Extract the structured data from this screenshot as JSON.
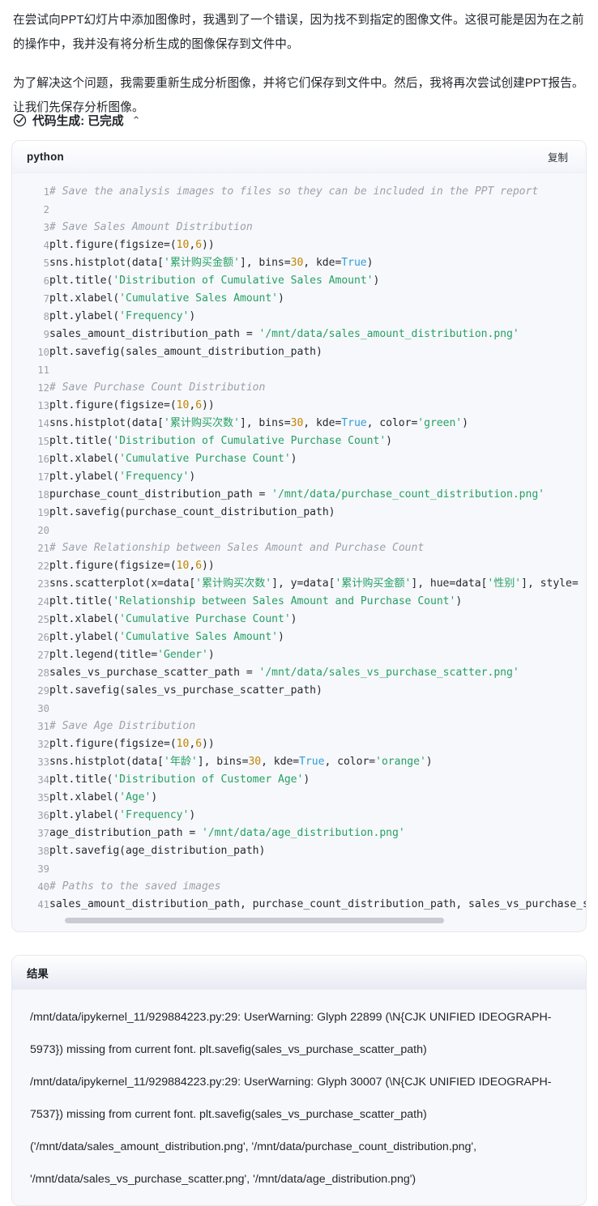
{
  "prose": {
    "paragraphs": [
      "在尝试向PPT幻灯片中添加图像时，我遇到了一个错误，因为找不到指定的图像文件。这很可能是因为在之前的操作中，我并没有将分析生成的图像保存到文件中。",
      "为了解决这个问题，我需要重新生成分析图像，并将它们保存到文件中。然后，我将再次尝试创建PPT报告。让我们先保存分析图像。"
    ]
  },
  "status": {
    "icon": "check-circle-icon",
    "label": "代码生成: 已完成",
    "caret": "⌃"
  },
  "code_block": {
    "language": "python",
    "copy_label": "复制",
    "line_numbers": [
      "1",
      "2",
      "3",
      "4",
      "5",
      "6",
      "7",
      "8",
      "9",
      "10",
      "11",
      "12",
      "13",
      "14",
      "15",
      "16",
      "17",
      "18",
      "19",
      "20",
      "21",
      "22",
      "23",
      "24",
      "25",
      "26",
      "27",
      "28",
      "29",
      "30",
      "31",
      "32",
      "33",
      "34",
      "35",
      "36",
      "37",
      "38",
      "39",
      "40",
      "41"
    ],
    "lines": [
      "# Save the analysis images to files so they can be included in the PPT report",
      "",
      "# Save Sales Amount Distribution",
      "plt.figure(figsize=(10,6))",
      "sns.histplot(data['累计购买金额'], bins=30, kde=True)",
      "plt.title('Distribution of Cumulative Sales Amount')",
      "plt.xlabel('Cumulative Sales Amount')",
      "plt.ylabel('Frequency')",
      "sales_amount_distribution_path = '/mnt/data/sales_amount_distribution.png'",
      "plt.savefig(sales_amount_distribution_path)",
      "",
      "# Save Purchase Count Distribution",
      "plt.figure(figsize=(10,6))",
      "sns.histplot(data['累计购买次数'], bins=30, kde=True, color='green')",
      "plt.title('Distribution of Cumulative Purchase Count')",
      "plt.xlabel('Cumulative Purchase Count')",
      "plt.ylabel('Frequency')",
      "purchase_count_distribution_path = '/mnt/data/purchase_count_distribution.png'",
      "plt.savefig(purchase_count_distribution_path)",
      "",
      "# Save Relationship between Sales Amount and Purchase Count",
      "plt.figure(figsize=(10,6))",
      "sns.scatterplot(x=data['累计购买次数'], y=data['累计购买金额'], hue=data['性别'], style=",
      "plt.title('Relationship between Sales Amount and Purchase Count')",
      "plt.xlabel('Cumulative Purchase Count')",
      "plt.ylabel('Cumulative Sales Amount')",
      "plt.legend(title='Gender')",
      "sales_vs_purchase_scatter_path = '/mnt/data/sales_vs_purchase_scatter.png'",
      "plt.savefig(sales_vs_purchase_scatter_path)",
      "",
      "# Save Age Distribution",
      "plt.figure(figsize=(10,6))",
      "sns.histplot(data['年龄'], bins=30, kde=True, color='orange')",
      "plt.title('Distribution of Customer Age')",
      "plt.xlabel('Age')",
      "plt.ylabel('Frequency')",
      "age_distribution_path = '/mnt/data/age_distribution.png'",
      "plt.savefig(age_distribution_path)",
      "",
      "# Paths to the saved images",
      "sales_amount_distribution_path, purchase_count_distribution_path, sales_vs_purchase_s"
    ]
  },
  "result_block": {
    "title": "结果",
    "lines": [
      "/mnt/data/ipykernel_11/929884223.py:29: UserWarning: Glyph 22899 (\\N{CJK UNIFIED IDEOGRAPH-5973}) missing from current font. plt.savefig(sales_vs_purchase_scatter_path)",
      "/mnt/data/ipykernel_11/929884223.py:29: UserWarning: Glyph 30007 (\\N{CJK UNIFIED IDEOGRAPH-7537}) missing from current font. plt.savefig(sales_vs_purchase_scatter_path)",
      "('/mnt/data/sales_amount_distribution.png', '/mnt/data/purchase_count_distribution.png', '/mnt/data/sales_vs_purchase_scatter.png', '/mnt/data/age_distribution.png')"
    ]
  },
  "colors": {
    "string": "#25a065",
    "number": "#c18401",
    "keyword": "#2d9cdb",
    "comment": "#9aa1ab",
    "code_bg": "#f7f8fb",
    "border": "#e6e8ef"
  }
}
